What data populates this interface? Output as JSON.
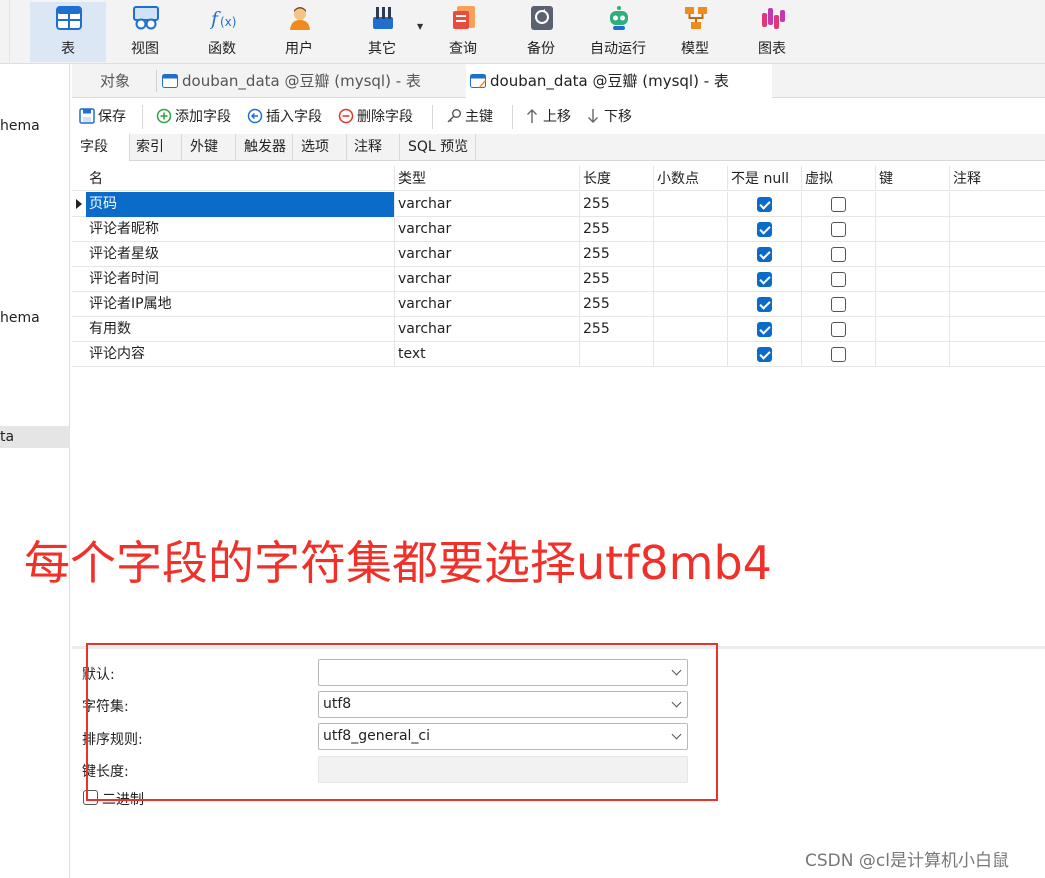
{
  "ribbon": {
    "buttons": [
      {
        "label": "表",
        "icon": "table-icon"
      },
      {
        "label": "视图",
        "icon": "view-icon"
      },
      {
        "label": "函数",
        "icon": "function-icon"
      },
      {
        "label": "用户",
        "icon": "user-icon"
      },
      {
        "label": "其它",
        "icon": "tools-icon"
      },
      {
        "label": "查询",
        "icon": "query-icon"
      },
      {
        "label": "备份",
        "icon": "backup-icon"
      },
      {
        "label": "自动运行",
        "icon": "robot-icon"
      },
      {
        "label": "模型",
        "icon": "model-icon"
      },
      {
        "label": "图表",
        "icon": "chart-icon"
      }
    ],
    "active": "表"
  },
  "left_panel": {
    "items": [
      "hema",
      "hema",
      "ta"
    ],
    "selected": "ta"
  },
  "tabs": [
    {
      "label": "对象"
    },
    {
      "label": "douban_data @豆瓣 (mysql) - 表"
    },
    {
      "label": "douban_data @豆瓣 (mysql) - 表"
    }
  ],
  "toolbar": {
    "save": "保存",
    "add_field": "添加字段",
    "insert_field": "插入字段",
    "delete_field": "删除字段",
    "primary_key": "主键",
    "move_up": "上移",
    "move_down": "下移"
  },
  "subtabs": [
    "字段",
    "索引",
    "外键",
    "触发器",
    "选项",
    "注释",
    "SQL 预览"
  ],
  "grid": {
    "columns": [
      "名",
      "类型",
      "长度",
      "小数点",
      "不是 null",
      "虚拟",
      "键",
      "注释"
    ],
    "rows": [
      {
        "name": "页码",
        "type": "varchar",
        "length": "255",
        "not_null": true,
        "virtual": false
      },
      {
        "name": "评论者昵称",
        "type": "varchar",
        "length": "255",
        "not_null": true,
        "virtual": false
      },
      {
        "name": "评论者星级",
        "type": "varchar",
        "length": "255",
        "not_null": true,
        "virtual": false
      },
      {
        "name": "评论者时间",
        "type": "varchar",
        "length": "255",
        "not_null": true,
        "virtual": false
      },
      {
        "name": "评论者IP属地",
        "type": "varchar",
        "length": "255",
        "not_null": true,
        "virtual": false
      },
      {
        "name": "有用数",
        "type": "varchar",
        "length": "255",
        "not_null": true,
        "virtual": false
      },
      {
        "name": "评论内容",
        "type": "text",
        "length": "",
        "not_null": true,
        "virtual": false
      }
    ]
  },
  "annotation": "每个字段的字符集都要选择utf8mb4",
  "properties": {
    "default_label": "默认:",
    "default_value": "",
    "charset_label": "字符集:",
    "charset_value": "utf8",
    "collation_label": "排序规则:",
    "collation_value": "utf8_general_ci",
    "key_length_label": "键长度:",
    "key_length_value": "",
    "binary_label": "二进制"
  },
  "watermark": "CSDN @cl是计算机小白鼠",
  "colors": {
    "accent": "#0a6bc8",
    "annotation": "#f0312a",
    "highlight_box": "#e8332d"
  }
}
